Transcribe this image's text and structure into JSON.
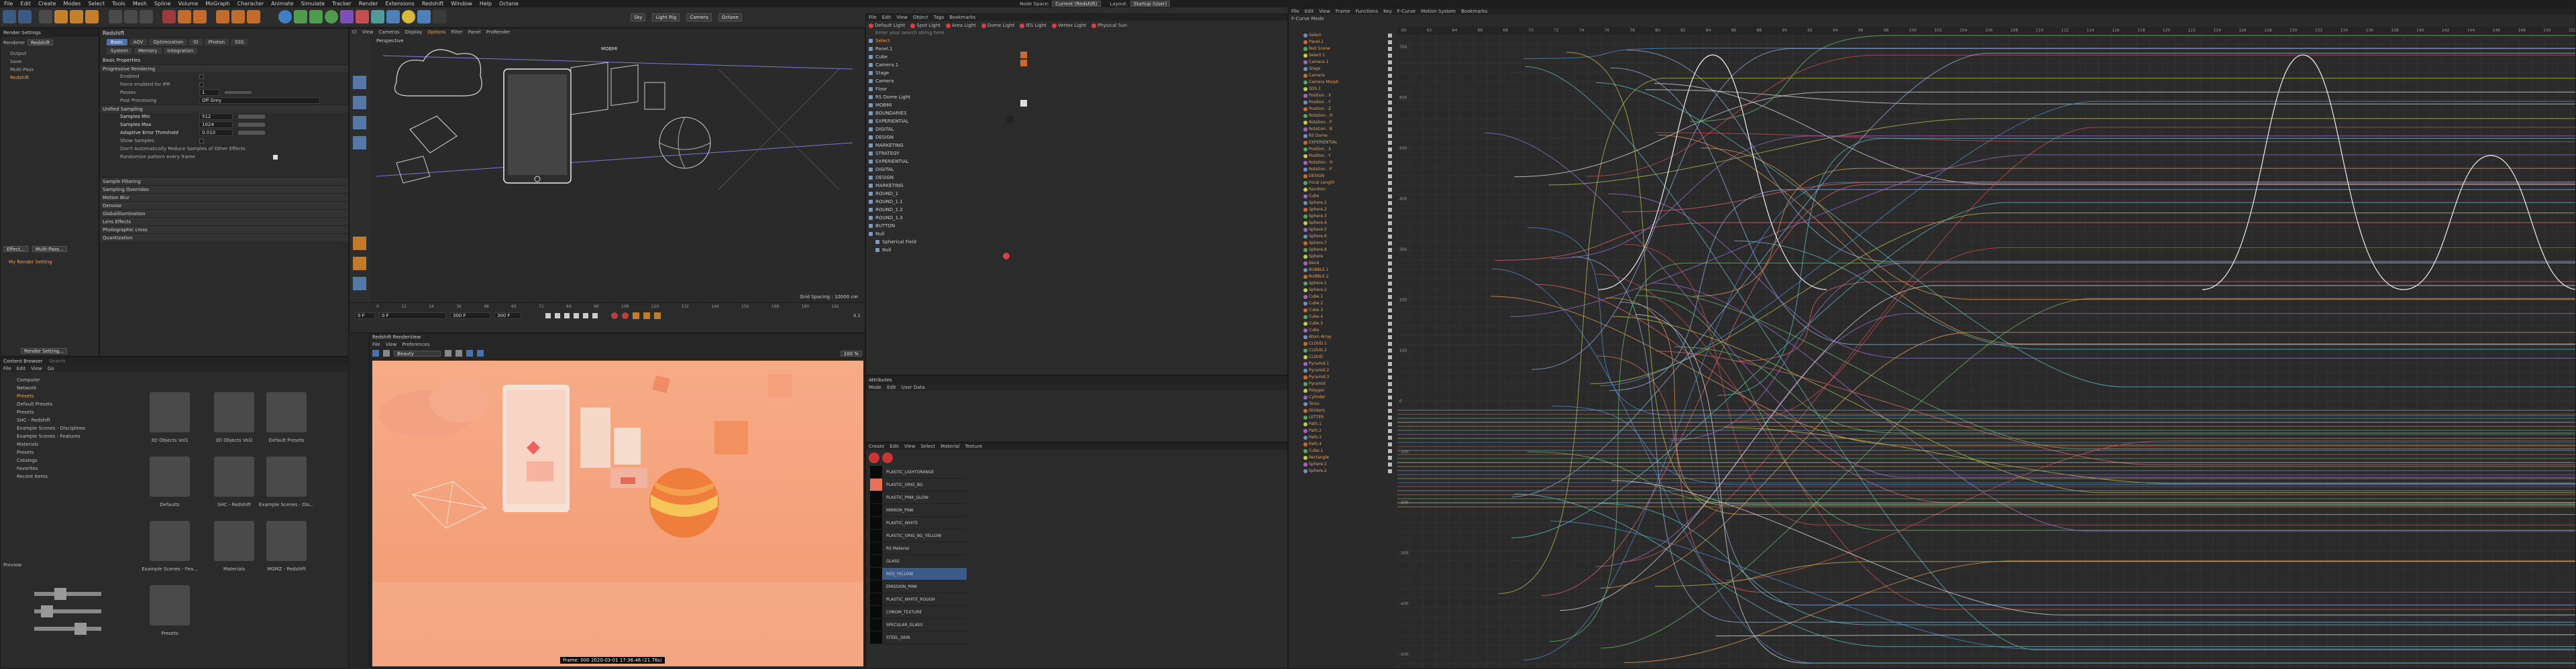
{
  "menubar": {
    "items": [
      "File",
      "Edit",
      "Create",
      "Modes",
      "Select",
      "Tools",
      "Mesh",
      "Spline",
      "Volume",
      "MoGraph",
      "Character",
      "Animate",
      "Simulate",
      "Tracker",
      "Render",
      "Extensions",
      "Redshift",
      "Window",
      "Help",
      "Octane"
    ],
    "node_space_label": "Node Space:",
    "node_space_value": "Current (Redshift)",
    "layout_label": "Layout:",
    "layout_value": "Startup (User)"
  },
  "toolbar": {
    "right_buttons": [
      "Sky",
      "Light Rig",
      "Camera",
      "Octane"
    ]
  },
  "render_settings": {
    "title": "Render Settings",
    "renderer_label": "Renderer",
    "renderer_value": "Redshift",
    "list": [
      "Output",
      "Save",
      "Multi-Pass",
      "Redshift"
    ],
    "effect_button": "Effect...",
    "multipass_button": "Multi-Pass...",
    "my_settings": "My Render Setting",
    "render_button": "Render Setting...",
    "header": "Redshift",
    "tabs": [
      "Basic",
      "AOV",
      "Optimization",
      "GI",
      "Photon",
      "SSS"
    ],
    "tabs2": [
      "System",
      "Memory",
      "Integration"
    ],
    "section_basic": "Basic Properties",
    "section_progressive": "Progressive Rendering",
    "progressive_rows": [
      {
        "label": "Enabled",
        "value": ""
      },
      {
        "label": "Force enabled for IPR",
        "value": ""
      },
      {
        "label": "Passes",
        "value": "1"
      },
      {
        "label": "Post Processing",
        "value": "Off Grey"
      }
    ],
    "section_unified": "Unified Sampling",
    "unified_rows": [
      {
        "label": "Samples Min",
        "value": "512"
      },
      {
        "label": "Samples Max",
        "value": "1024"
      },
      {
        "label": "Adaptive Error Threshold",
        "value": "0.010"
      },
      {
        "label": "Show Samples",
        "value": ""
      },
      {
        "label": "Don't Automatically Reduce Samples of Other Effects",
        "value": ""
      },
      {
        "label": "Randomize pattern every frame",
        "value": ""
      }
    ],
    "collapsed_sections": [
      "Sample Filtering",
      "Sampling Overrides",
      "Motion Blur",
      "Denoise",
      "Globalillumination",
      "Lens Effects",
      "Photographic cross",
      "Quantization"
    ]
  },
  "content_browser": {
    "title": "Content Browser",
    "search_placeholder": "Search",
    "menu": [
      "File",
      "Edit",
      "View",
      "Go"
    ],
    "tree": [
      "Computer",
      "Network",
      "Presets",
      "Default Presets",
      "Presets",
      "SHC - Redshift",
      "Example Scenes - Disciplines",
      "Example Scenes - Features",
      "Materials",
      "Presets",
      "Catalogs",
      "Favorites",
      "Recent Items"
    ],
    "folders": [
      "3D Objects Vol1",
      "3D Objects Vol2",
      "Default Presets",
      "Defaults",
      "SHC - Redshift",
      "Example Scenes - Dis...",
      "Example Scenes - Fea...",
      "Materials",
      "MGMZ - Redshift",
      "Presets"
    ],
    "preview_label": "Preview"
  },
  "viewport": {
    "menu": [
      "Cl",
      "View",
      "Cameras",
      "Display",
      "Options",
      "Filter",
      "Panel",
      "ProRender"
    ],
    "label": "Perspective",
    "camera_label": "MOBMI",
    "grid_spacing": "Grid Spacing : 10000 cm",
    "timeline_ticks": [
      "0",
      "12",
      "24",
      "36",
      "48",
      "60",
      "72",
      "84",
      "96",
      "108",
      "120",
      "132",
      "144",
      "156",
      "168",
      "180",
      "192"
    ],
    "frame_start": "0 F",
    "frame_current": "0 F",
    "frame_end": "300 F",
    "frame_end2": "300 F",
    "fps": "4.1"
  },
  "render_view": {
    "title": "Redshift RenderView",
    "menu": [
      "File",
      "View",
      "Preferences"
    ],
    "combo": "Beauty",
    "zoom": "100 %",
    "status": "Frame: 000  2020-03-01 17:36:46  (21.76s)"
  },
  "objects": {
    "menu": [
      "File",
      "Edit",
      "View",
      "Object",
      "Tags",
      "Bookmarks"
    ],
    "search_placeholder": "Enter your search string here",
    "toolbar_buttons": [
      "Default Light",
      "Spot Light",
      "Area Light",
      "Dome Light",
      "IES Light",
      "Vertex Light",
      "Physical Sun"
    ],
    "rows": [
      "Select",
      "Panel.1",
      "Cube",
      "Camera.1",
      "Stage",
      "Camera",
      "Floor",
      "RS Dome Light",
      "MOBMI",
      "BOUNDARIES",
      "EXPERIENTIAL",
      "DIGITAL",
      "DESIGN",
      "MARKETING",
      "STRATEGY",
      "EXPERIENTIAL",
      "DIGITAL",
      "DESIGN",
      "MARKETING",
      "ROUND_1",
      "ROUND_1.1",
      "ROUND_1.2",
      "ROUND_1.3",
      "BUTTON",
      "Null",
      "Spherical Field",
      "Null"
    ]
  },
  "attributes": {
    "title": "Attributes",
    "menu": [
      "Mode",
      "Edit",
      "User Data"
    ]
  },
  "materials": {
    "menu": [
      "Create",
      "Edit",
      "View",
      "Select",
      "Material",
      "Texture"
    ],
    "rows": [
      "PLASTIC_LIGHTORANGE",
      "PLASTIC_ORIG_BG",
      "PLASTIC_PINK_GLOW",
      "MIRROR_PINK",
      "PLASTIC_WHITE",
      "PLASTIC_ORIG_BG_YELLOW",
      "RS Material",
      "GLASS",
      "RED_YELLOW",
      "EMISSION_PINK",
      "PLASTIC_WHITE_ROUGH",
      "CHROM_TEXTURE",
      "SPECULAR_GLASS",
      "STEEL_SKIN"
    ]
  },
  "fcurve": {
    "title": "F-Curve Mode",
    "menu": [
      "File",
      "Edit",
      "View",
      "Frame",
      "Functions",
      "Key",
      "F-Curve",
      "Motion System",
      "Bookmarks"
    ],
    "ruler": [
      "60",
      "62",
      "64",
      "66",
      "68",
      "70",
      "72",
      "74",
      "76",
      "78",
      "80",
      "82",
      "84",
      "86",
      "88",
      "90",
      "92",
      "94",
      "96",
      "98",
      "100",
      "102",
      "104",
      "106",
      "108",
      "110",
      "112",
      "114",
      "116",
      "118",
      "120",
      "122",
      "124",
      "126",
      "128",
      "130",
      "132",
      "134",
      "136",
      "138",
      "140",
      "142",
      "144",
      "146",
      "148",
      "150",
      "152"
    ],
    "y_ticks": [
      "700",
      "600",
      "500",
      "400",
      "300",
      "200",
      "100",
      "0",
      "-100",
      "-200",
      "-300",
      "-400",
      "-500"
    ],
    "tracks": [
      "Select",
      "Panel.1",
      "Null Scene",
      "Select 1",
      "Camera.1",
      "Stage",
      "Camera",
      "Camera Morph",
      "SDS.1",
      "Position . X",
      "Position . Y",
      "Position . Z",
      "Rotation . H",
      "Rotation . P",
      "Rotation . B",
      "RS Dome",
      "EXPERIENTIAL",
      "Position . X",
      "Position . Y",
      "Rotation . H",
      "Rotation . P",
      "DESIGN",
      "Focal Length",
      "Random",
      "Cube",
      "Sphere.1",
      "Sphere.2",
      "Sphere.3",
      "Sphere.4",
      "Sphere.5",
      "Sphere.6",
      "Sphere.7",
      "Sphere.8",
      "Sphere",
      "Bend",
      "BUBBLE.1",
      "BUBBLE.2",
      "Sphere.1",
      "Sphere.2",
      "Cube.1",
      "Cube.2",
      "Cube.3",
      "Cube.4",
      "Cube.5",
      "Cube",
      "Atom Array",
      "CLOUD.1",
      "CLOUD.2",
      "CLOUD",
      "Pyramid.1",
      "Pyramid.2",
      "Pyramid.3",
      "Pyramid",
      "Polygon",
      "Cylinder",
      "Torus",
      "Stickers",
      "LETTER",
      "Path.1",
      "Path.2",
      "Path.3",
      "Path.4",
      "Cube.1",
      "Rectangle",
      "Sphere.1",
      "Sphere.2"
    ]
  },
  "colors": {
    "accent": "#4b72b0",
    "selection_orange": "#f0a040",
    "render_bg": "#f4a07a"
  }
}
